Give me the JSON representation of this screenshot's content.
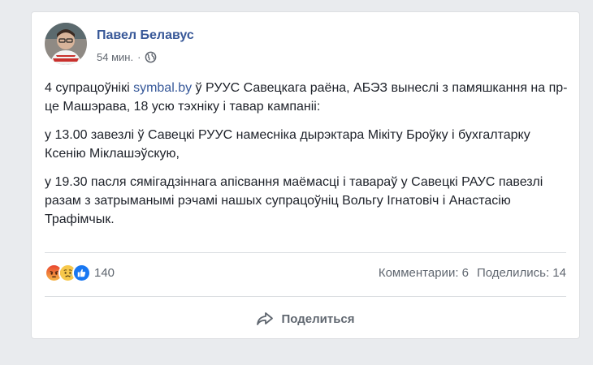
{
  "post": {
    "author": "Павел Белавус",
    "time": "54 мин.",
    "separator": "·",
    "paragraph1_before_link": "4 супрацоўнікі ",
    "paragraph1_link": "symbal.by",
    "paragraph1_after_link": " ў РУУС Савецкага раёна, АБЭЗ вынеслі з памяшкання на пр-це Машэрава, 18 усю тэхніку і тавар кампаніі:",
    "paragraph2": "у 13.00 завезлі ў Савецкі РУУС намесніка дырэктара Мікіту Броўку і бухгалтарку Ксенію Міклашэўскую,",
    "paragraph3": "у 19.30 пасля сямігадзіннага апісвання маёмасці і тавараў у Савецкі РАУС павезлі разам з затрыманымі рэчамі нашых супрацоўніц Вольгу Ігнатовіч і Анастасію Трафімчык."
  },
  "reactions": {
    "icons": [
      "angry-icon",
      "sad-icon",
      "like-icon"
    ],
    "count": "140"
  },
  "stats": {
    "comments": "Комментарии: 6",
    "shares": "Поделились: 14"
  },
  "actions": {
    "share_label": "Поделиться"
  },
  "colors": {
    "author_link": "#385898",
    "text": "#1d2129",
    "muted": "#606770",
    "like_blue": "#1877f2",
    "angry_red": "#e9710f"
  }
}
